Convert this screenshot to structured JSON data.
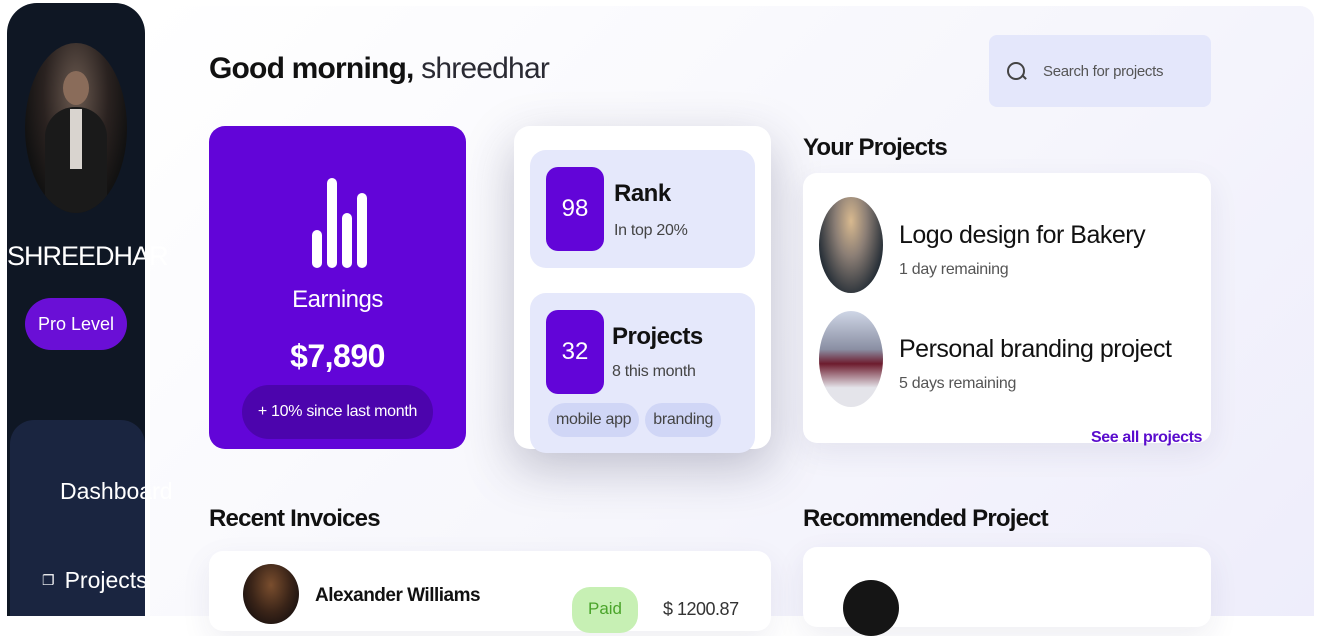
{
  "sidebar": {
    "username": "SHREEDHAR",
    "level_badge": "Pro Level",
    "nav": [
      {
        "label": "Dashboard",
        "icon": "dashboard-icon"
      },
      {
        "label": "Projects",
        "icon": "projects-icon"
      }
    ]
  },
  "header": {
    "greeting": "Good morning,",
    "name": "shreedhar",
    "search_placeholder": "Search for projects"
  },
  "earnings": {
    "label": "Earnings",
    "value": "$7,890",
    "growth": "+ 10% since last month",
    "icon": "bar-chart-icon"
  },
  "stats": {
    "rank": {
      "number": "98",
      "title": "Rank",
      "subtitle": "In top 20%"
    },
    "projects": {
      "number": "32",
      "title": "Projects",
      "subtitle": "8 this month",
      "tags": [
        "mobile app",
        "branding"
      ]
    }
  },
  "your_projects": {
    "title": "Your Projects",
    "items": [
      {
        "name": "Logo design for Bakery",
        "due": "1 day remaining"
      },
      {
        "name": "Personal branding project",
        "due": "5 days remaining"
      }
    ],
    "see_all": "See all projects"
  },
  "recent_invoices": {
    "title": "Recent Invoices",
    "items": [
      {
        "name": "Alexander Williams",
        "status": "Paid",
        "amount": "$ 1200.87"
      }
    ]
  },
  "recommended": {
    "title": "Recommended Project"
  },
  "colors": {
    "accent": "#6205d8",
    "sidebar_bg": "#0f1724",
    "search_bg": "#e4e7fb"
  }
}
